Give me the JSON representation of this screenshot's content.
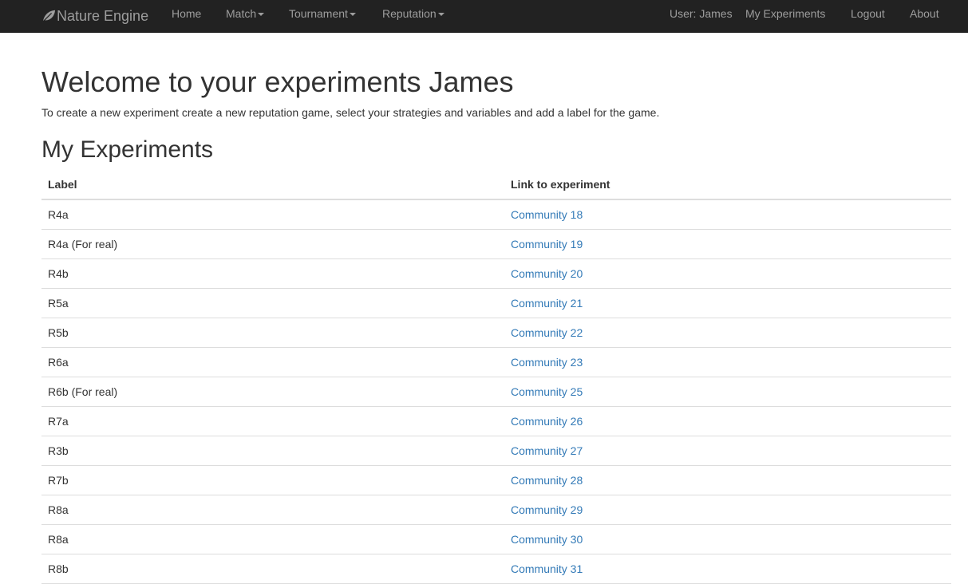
{
  "navbar": {
    "brand": "Nature Engine",
    "brand_icon": "leaf-icon",
    "items_left": [
      {
        "label": "Home",
        "dropdown": false
      },
      {
        "label": "Match",
        "dropdown": true
      },
      {
        "label": "Tournament",
        "dropdown": true
      },
      {
        "label": "Reputation",
        "dropdown": true
      }
    ],
    "user": "User: James",
    "my_experiments": "My Experiments",
    "logout": "Logout",
    "about": "About",
    "colors": {
      "background": "#222222",
      "text": "#9d9d9d"
    }
  },
  "main": {
    "title": "Welcome to your experiments James",
    "intro": "To create a new experiment create a new reputation game, select your strategies and variables and add a label for the game.",
    "section_title": "My Experiments",
    "table": {
      "headers": [
        "Label",
        "Link to experiment"
      ],
      "rows": [
        {
          "label": "R4a",
          "link": "Community 18"
        },
        {
          "label": "R4a (For real)",
          "link": "Community 19"
        },
        {
          "label": "R4b",
          "link": "Community 20"
        },
        {
          "label": "R5a",
          "link": "Community 21"
        },
        {
          "label": "R5b",
          "link": "Community 22"
        },
        {
          "label": "R6a",
          "link": "Community 23"
        },
        {
          "label": "R6b (For real)",
          "link": "Community 25"
        },
        {
          "label": "R7a",
          "link": "Community 26"
        },
        {
          "label": "R3b",
          "link": "Community 27"
        },
        {
          "label": "R7b",
          "link": "Community 28"
        },
        {
          "label": "R8a",
          "link": "Community 29"
        },
        {
          "label": "R8a",
          "link": "Community 30"
        },
        {
          "label": "R8b",
          "link": "Community 31"
        }
      ]
    },
    "link_color": "#337ab7"
  }
}
